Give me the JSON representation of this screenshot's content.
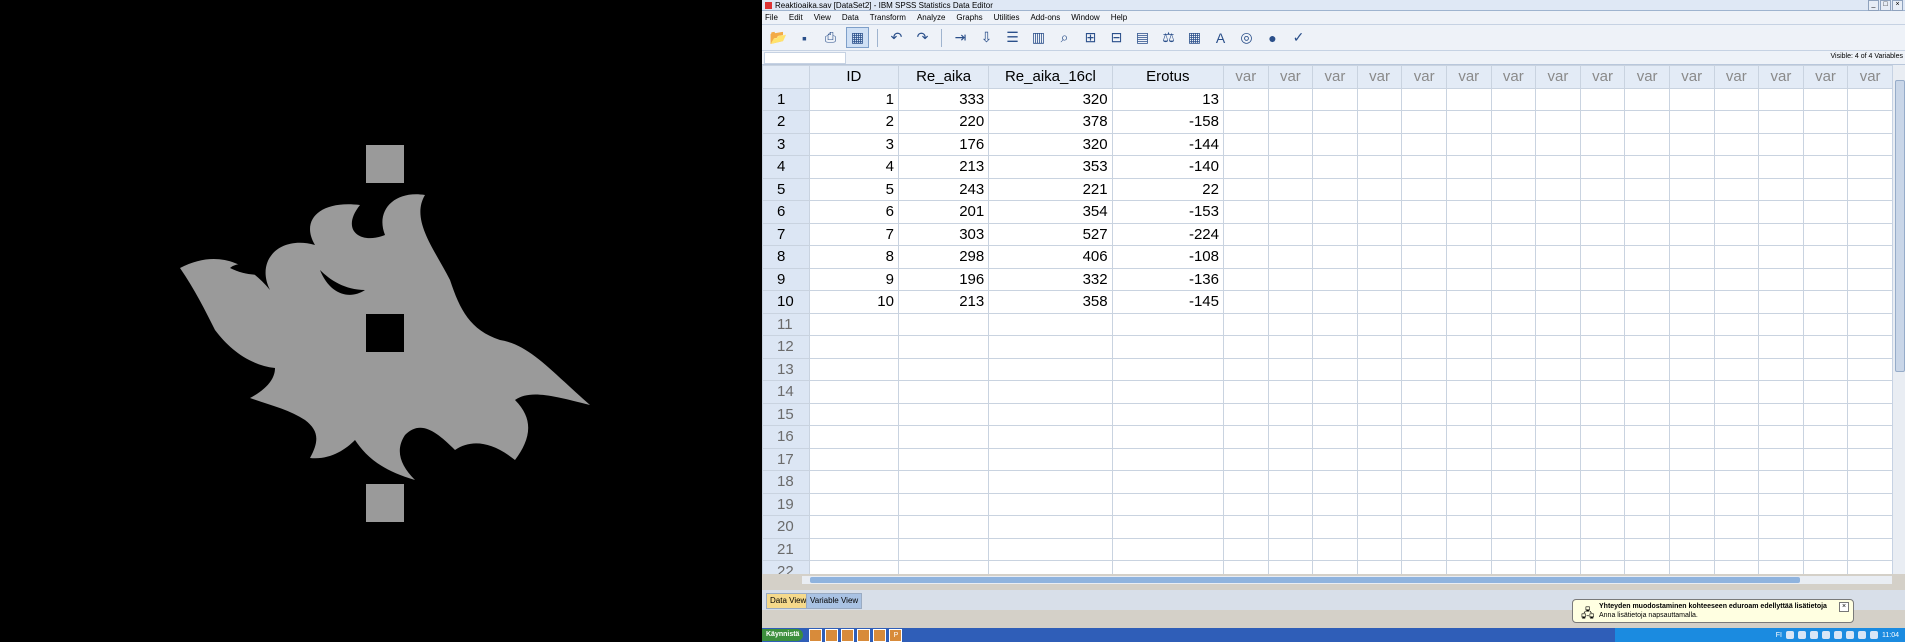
{
  "window": {
    "title": "Reaktioaika.sav [DataSet2] - IBM SPSS Statistics Data Editor"
  },
  "menu": [
    "File",
    "Edit",
    "View",
    "Data",
    "Transform",
    "Analyze",
    "Graphs",
    "Utilities",
    "Add-ons",
    "Window",
    "Help"
  ],
  "toolbar_icons": [
    "open-icon",
    "save-icon",
    "print-icon",
    "dialog-recall-icon",
    "undo-icon",
    "redo-icon",
    "goto-case-icon",
    "goto-variable-icon",
    "variables-icon",
    "run-descriptives-icon",
    "find-icon",
    "insert-cases-icon",
    "insert-variable-icon",
    "split-file-icon",
    "weight-cases-icon",
    "select-cases-icon",
    "value-labels-icon",
    "use-sets-icon",
    "show-all-variables-icon",
    "spell-check-icon"
  ],
  "status": {
    "visible": "Visible: 4 of 4 Variables"
  },
  "grid": {
    "columns": [
      "ID",
      "Re_aika",
      "Re_aika_16cl",
      "Erotus"
    ],
    "var_columns": [
      "var",
      "var",
      "var",
      "var",
      "var",
      "var",
      "var",
      "var",
      "var",
      "var",
      "var",
      "var",
      "var",
      "var",
      "var"
    ],
    "rows": [
      [
        "1",
        "1",
        "333",
        "320",
        "13"
      ],
      [
        "2",
        "2",
        "220",
        "378",
        "-158"
      ],
      [
        "3",
        "3",
        "176",
        "320",
        "-144"
      ],
      [
        "4",
        "4",
        "213",
        "353",
        "-140"
      ],
      [
        "5",
        "5",
        "243",
        "221",
        "22"
      ],
      [
        "6",
        "6",
        "201",
        "354",
        "-153"
      ],
      [
        "7",
        "7",
        "303",
        "527",
        "-224"
      ],
      [
        "8",
        "8",
        "298",
        "406",
        "-108"
      ],
      [
        "9",
        "9",
        "196",
        "332",
        "-136"
      ],
      [
        "10",
        "10",
        "213",
        "358",
        "-145"
      ]
    ],
    "empty_rows": [
      "11",
      "12",
      "13",
      "14",
      "15",
      "16",
      "17",
      "18",
      "19",
      "20",
      "21",
      "22"
    ]
  },
  "tabs": {
    "data_view": "Data View",
    "variable_view": "Variable View"
  },
  "notification": {
    "title": "Yhteyden muodostaminen kohteeseen eduroam edellyttää lisätietoja",
    "subtitle": "Anna lisätietoja napsauttamalla."
  },
  "taskbar": {
    "start": "Käynnistä",
    "language": "FI",
    "clock": "11:04"
  },
  "colors": {
    "logo": "#9a9a9a",
    "header_bg": "#e3ebf6",
    "active_tab": "#f5d98b",
    "taskbar": "#2f5eb8"
  }
}
